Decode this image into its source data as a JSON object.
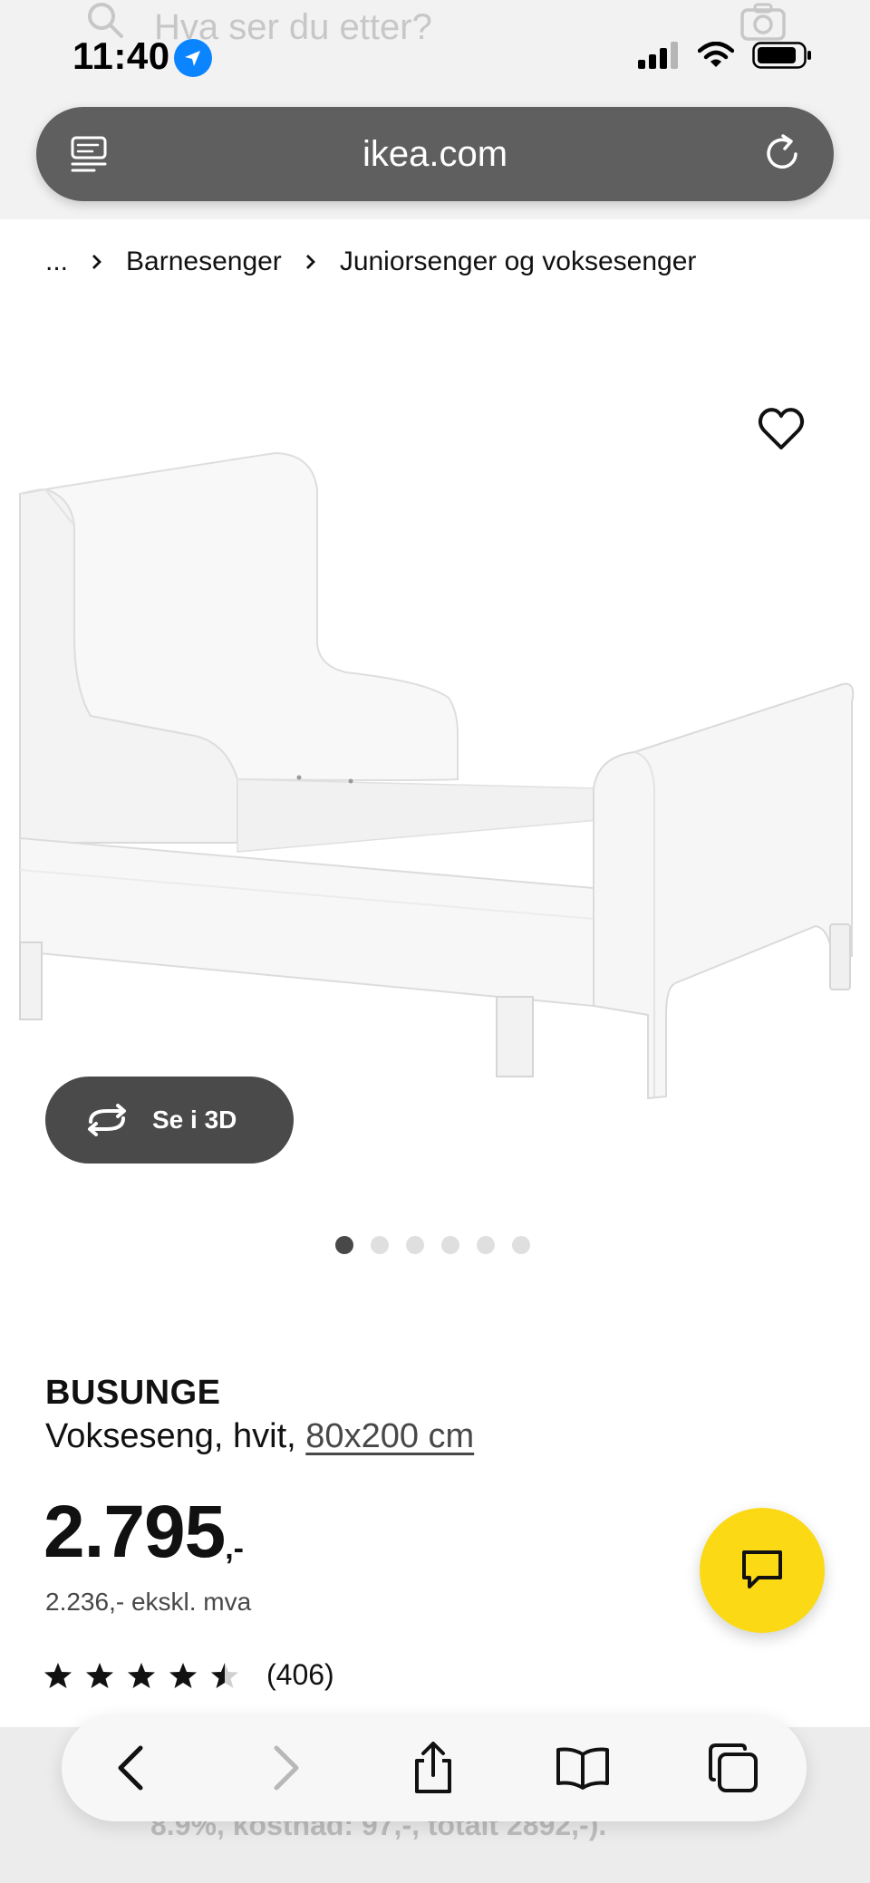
{
  "status_bar": {
    "time": "11:40"
  },
  "behind_header": {
    "search_placeholder": "Hva ser du etter?"
  },
  "address_bar": {
    "domain": "ikea.com"
  },
  "breadcrumb": {
    "ellipsis": "...",
    "items": [
      "Barnesenger",
      "Juniorsenger og voksesenger"
    ]
  },
  "gallery": {
    "view_3d_label": "Se i 3D",
    "image_count": 6,
    "active_index": 0
  },
  "product": {
    "name": "BUSUNGE",
    "description": "Vokseseng, hvit,",
    "size": "80x200 cm",
    "price": "2.795",
    "price_suffix": ",-",
    "price_ex_vat": "2.236,- ekskl. mva",
    "rating_value": 4.5,
    "rating_max": 5,
    "review_count": "(406)"
  },
  "bottom_peek": {
    "text": "8.9%, kostnad: 97,-, totalt 2892,-)."
  },
  "colors": {
    "accent_yellow": "#fbd914",
    "url_bar": "#5f5f5f",
    "button_dark": "#4a4a4a",
    "ios_blue": "#0a84ff"
  },
  "icons": {
    "chat": "chat-bubble-icon",
    "favorite": "heart-icon",
    "view_3d": "rotate-3d-icon",
    "back": "chevron-left-icon",
    "forward": "chevron-right-icon",
    "share": "share-icon",
    "bookmarks": "book-icon",
    "tabs": "tabs-icon"
  }
}
